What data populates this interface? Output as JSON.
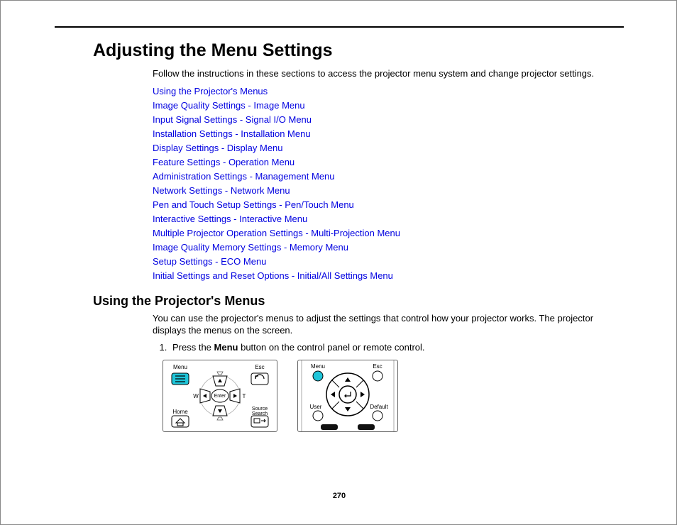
{
  "heading": "Adjusting the Menu Settings",
  "intro": "Follow the instructions in these sections to access the projector menu system and change projector settings.",
  "links": [
    "Using the Projector's Menus",
    "Image Quality Settings - Image Menu",
    "Input Signal Settings - Signal I/O Menu",
    "Installation Settings - Installation Menu",
    "Display Settings - Display Menu",
    "Feature Settings - Operation Menu",
    "Administration Settings - Management Menu",
    "Network Settings - Network Menu",
    "Pen and Touch Setup Settings - Pen/Touch Menu",
    "Interactive Settings - Interactive Menu",
    "Multiple Projector Operation Settings - Multi-Projection Menu",
    "Image Quality Memory Settings - Memory Menu",
    "Setup Settings - ECO Menu",
    "Initial Settings and Reset Options - Initial/All Settings Menu"
  ],
  "subheading": "Using the Projector's Menus",
  "subintro": "You can use the projector's menus to adjust the settings that control how your projector works. The projector displays the menus on the screen.",
  "step1_pre": "Press the ",
  "step1_bold": "Menu",
  "step1_post": " button on the control panel or remote control.",
  "pageNumber": "270",
  "panelA": {
    "menu": "Menu",
    "esc": "Esc",
    "w": "W",
    "t": "T",
    "enter": "Enter",
    "home": "Home",
    "source": "Source\nSearch"
  },
  "panelB": {
    "menu": "Menu",
    "esc": "Esc",
    "user": "User",
    "default": "Default"
  }
}
